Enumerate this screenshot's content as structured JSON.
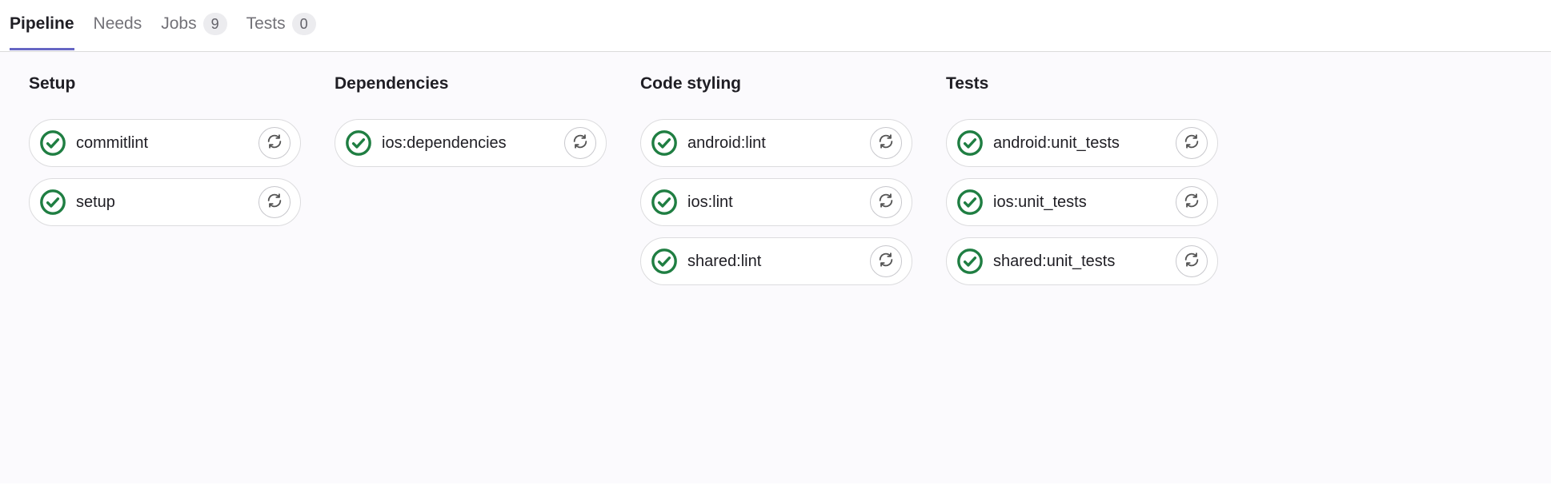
{
  "tabs": {
    "pipeline": {
      "label": "Pipeline"
    },
    "needs": {
      "label": "Needs"
    },
    "jobs": {
      "label": "Jobs",
      "count": "9"
    },
    "tests": {
      "label": "Tests",
      "count": "0"
    }
  },
  "stages": [
    {
      "name": "Setup",
      "jobs": [
        {
          "name": "commitlint",
          "status": "passed"
        },
        {
          "name": "setup",
          "status": "passed"
        }
      ]
    },
    {
      "name": "Dependencies",
      "jobs": [
        {
          "name": "ios:dependencies",
          "status": "passed"
        }
      ]
    },
    {
      "name": "Code styling",
      "jobs": [
        {
          "name": "android:lint",
          "status": "passed"
        },
        {
          "name": "ios:lint",
          "status": "passed"
        },
        {
          "name": "shared:lint",
          "status": "passed"
        }
      ]
    },
    {
      "name": "Tests",
      "jobs": [
        {
          "name": "android:unit_tests",
          "status": "passed"
        },
        {
          "name": "ios:unit_tests",
          "status": "passed"
        },
        {
          "name": "shared:unit_tests",
          "status": "passed"
        }
      ]
    }
  ],
  "colors": {
    "success": "#1f7e42",
    "tab_active_border": "#6666c4"
  }
}
